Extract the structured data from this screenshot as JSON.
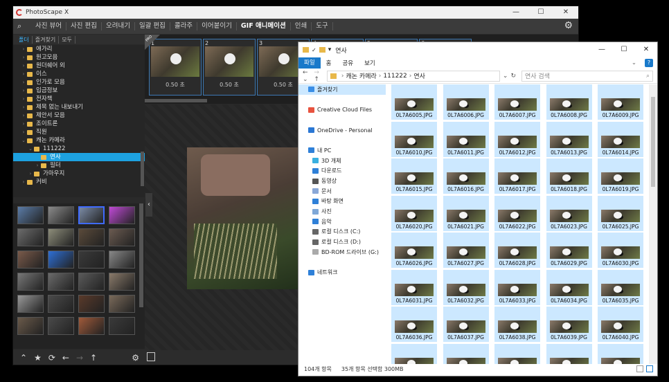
{
  "photoscape": {
    "title": "PhotoScape X",
    "window_controls": [
      "—",
      "☐",
      "✕"
    ],
    "menu": [
      "사진 뷰어",
      "사진 편집",
      "오려내기",
      "일괄 편집",
      "콜라주",
      "이어붙이기",
      "GIF 애니메이션",
      "인쇄",
      "도구"
    ],
    "active_menu": "GIF 애니메이션",
    "tabs": [
      "폴더",
      "즐겨찾기",
      "모두"
    ],
    "tree": [
      {
        "label": "애가리",
        "level": 0,
        "arrow": "›"
      },
      {
        "label": "원고모음",
        "level": 0,
        "arrow": "›"
      },
      {
        "label": "원더쉐어 외",
        "level": 0,
        "arrow": "›"
      },
      {
        "label": "이스",
        "level": 0,
        "arrow": "›"
      },
      {
        "label": "인가로 모음",
        "level": 0,
        "arrow": "›"
      },
      {
        "label": "입금정보",
        "level": 0,
        "arrow": "›"
      },
      {
        "label": "전자책",
        "level": 0,
        "arrow": "›"
      },
      {
        "label": "제목 없는 내보내기",
        "level": 0,
        "arrow": "›"
      },
      {
        "label": "제안서 모음",
        "level": 0,
        "arrow": "›"
      },
      {
        "label": "조이트론",
        "level": 0,
        "arrow": "›"
      },
      {
        "label": "직원",
        "level": 0,
        "arrow": "›"
      },
      {
        "label": "캐논 카메라",
        "level": 0,
        "arrow": "⌄"
      },
      {
        "label": "111222",
        "level": 1,
        "arrow": "⌄"
      },
      {
        "label": "연사",
        "level": 2,
        "arrow": "",
        "selected": true
      },
      {
        "label": "필터",
        "level": 2,
        "arrow": "›"
      },
      {
        "label": "가마우지",
        "level": 1,
        "arrow": "›"
      },
      {
        "label": "커비",
        "level": 0,
        "arrow": "›"
      }
    ],
    "frames": [
      {
        "num": "1",
        "time": "0.50 초"
      },
      {
        "num": "2",
        "time": "0.50 초"
      },
      {
        "num": "3",
        "time": "0.50 초"
      },
      {
        "num": "4",
        "time": ""
      },
      {
        "num": "5",
        "time": ""
      },
      {
        "num": "6",
        "time": ""
      }
    ],
    "pro_badge": "PRO",
    "thumb_colors": [
      "#5b7ca8",
      "#8a8a8a",
      "#7a8aa5",
      "#c04ad6",
      "#6b6b6b",
      "#8d8d7a",
      "#5a4a3a",
      "#6a5a50",
      "#7a5a4a",
      "#2e6fd6",
      "#3a3a3a",
      "#888888",
      "#777777",
      "#6a6a6a",
      "#5a5a5a",
      "#8a7a6a",
      "#999999",
      "#4a4a4a",
      "#5a3a2a",
      "#7a6a5a",
      "#6a5a4a",
      "#4a4a4a",
      "#a05a3a",
      "#3a3a3a"
    ],
    "selected_thumb": 2,
    "collapse_arrow": "‹"
  },
  "explorer": {
    "title": "연사",
    "window_controls": [
      "—",
      "☐",
      "✕"
    ],
    "ribbon": [
      "파일",
      "홈",
      "공유",
      "보기"
    ],
    "help": "?",
    "breadcrumb": [
      "캐논 카메라",
      "111222",
      "연사"
    ],
    "search_placeholder": "연사 검색",
    "nav": [
      {
        "label": "즐겨찾기",
        "icon": "#3a8ee6",
        "sel": true
      },
      {
        "label": "",
        "icon": "",
        "sel": false
      },
      {
        "label": "Creative Cloud Files",
        "icon": "#e8533f",
        "sel": false
      },
      {
        "label": "",
        "icon": "",
        "sel": false
      },
      {
        "label": "OneDrive - Personal",
        "icon": "#2b78d4",
        "sel": false
      },
      {
        "label": "",
        "icon": "",
        "sel": false
      },
      {
        "label": "내 PC",
        "icon": "#2f80d8",
        "sel": false
      },
      {
        "label": "3D 개체",
        "icon": "#3ab0e0",
        "sel": false,
        "ind": true
      },
      {
        "label": "다운로드",
        "icon": "#2f80d8",
        "sel": false,
        "ind": true
      },
      {
        "label": "동영상",
        "icon": "#555555",
        "sel": false,
        "ind": true
      },
      {
        "label": "문서",
        "icon": "#8aa8d8",
        "sel": false,
        "ind": true
      },
      {
        "label": "바탕 화면",
        "icon": "#2f80d8",
        "sel": false,
        "ind": true
      },
      {
        "label": "사진",
        "icon": "#7fa8d8",
        "sel": false,
        "ind": true
      },
      {
        "label": "음악",
        "icon": "#2f80d8",
        "sel": false,
        "ind": true
      },
      {
        "label": "로컬 디스크 (C:)",
        "icon": "#666666",
        "sel": false,
        "ind": true
      },
      {
        "label": "로컬 디스크 (D:)",
        "icon": "#666666",
        "sel": false,
        "ind": true
      },
      {
        "label": "BD-ROM 드라이브 (G:)",
        "icon": "#aaaaaa",
        "sel": false,
        "ind": true
      },
      {
        "label": "",
        "icon": "",
        "sel": false
      },
      {
        "label": "네트워크",
        "icon": "#2f80d8",
        "sel": false
      }
    ],
    "files": [
      "0L7A6005.JPG",
      "0L7A6006.JPG",
      "0L7A6007.JPG",
      "0L7A6008.JPG",
      "0L7A6009.JPG",
      "0L7A6010.JPG",
      "0L7A6011.JPG",
      "0L7A6012.JPG",
      "0L7A6013.JPG",
      "0L7A6014.JPG",
      "0L7A6015.JPG",
      "0L7A6016.JPG",
      "0L7A6017.JPG",
      "0L7A6018.JPG",
      "0L7A6019.JPG",
      "0L7A6020.JPG",
      "0L7A6021.JPG",
      "0L7A6022.JPG",
      "0L7A6023.JPG",
      "0L7A6025.JPG",
      "0L7A6026.JPG",
      "0L7A6027.JPG",
      "0L7A6028.JPG",
      "0L7A6029.JPG",
      "0L7A6030.JPG",
      "0L7A6031.JPG",
      "0L7A6032.JPG",
      "0L7A6033.JPG",
      "0L7A6034.JPG",
      "0L7A6035.JPG",
      "0L7A6036.JPG",
      "0L7A6037.JPG",
      "0L7A6038.JPG",
      "0L7A6039.JPG",
      "0L7A6040.JPG",
      "",
      "",
      "",
      "",
      ""
    ],
    "status_count": "104개 항목",
    "status_selected": "35개 항목 선택함 300MB"
  }
}
